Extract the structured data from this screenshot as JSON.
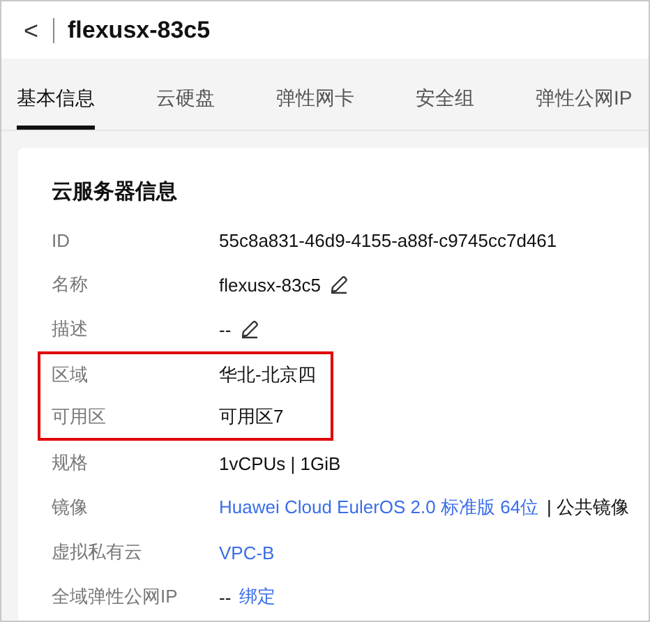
{
  "header": {
    "back_icon": "<",
    "title": "flexusx-83c5"
  },
  "tabs": [
    {
      "label": "基本信息",
      "selected": true
    },
    {
      "label": "云硬盘",
      "selected": false
    },
    {
      "label": "弹性网卡",
      "selected": false
    },
    {
      "label": "安全组",
      "selected": false
    },
    {
      "label": "弹性公网IP",
      "selected": false
    }
  ],
  "card": {
    "title": "云服务器信息",
    "rows": [
      {
        "label": "ID",
        "highlighted": false,
        "editable": false,
        "value": [
          {
            "kind": "text",
            "text": "55c8a831-46d9-4155-a88f-c9745cc7d461"
          }
        ]
      },
      {
        "label": "名称",
        "highlighted": false,
        "editable": true,
        "value": [
          {
            "kind": "text",
            "text": "flexusx-83c5"
          }
        ]
      },
      {
        "label": "描述",
        "highlighted": false,
        "editable": true,
        "value": [
          {
            "kind": "text",
            "text": "--"
          }
        ]
      },
      {
        "label": "区域",
        "highlighted": true,
        "editable": false,
        "value": [
          {
            "kind": "text",
            "text": "华北-北京四"
          }
        ]
      },
      {
        "label": "可用区",
        "highlighted": true,
        "editable": false,
        "value": [
          {
            "kind": "text",
            "text": "可用区7"
          }
        ]
      },
      {
        "label": "规格",
        "highlighted": false,
        "editable": false,
        "value": [
          {
            "kind": "text",
            "text": "1vCPUs | 1GiB"
          }
        ]
      },
      {
        "label": "镜像",
        "highlighted": false,
        "editable": false,
        "value": [
          {
            "kind": "link",
            "text": "Huawei Cloud EulerOS 2.0 标准版 64位"
          },
          {
            "kind": "text",
            "text": "| 公共镜像"
          }
        ]
      },
      {
        "label": "虚拟私有云",
        "highlighted": false,
        "editable": false,
        "value": [
          {
            "kind": "link",
            "text": "VPC-B"
          }
        ]
      },
      {
        "label": "全域弹性公网IP",
        "highlighted": false,
        "editable": false,
        "value": [
          {
            "kind": "text",
            "text": "--"
          },
          {
            "kind": "link",
            "text": "绑定"
          }
        ]
      }
    ]
  }
}
